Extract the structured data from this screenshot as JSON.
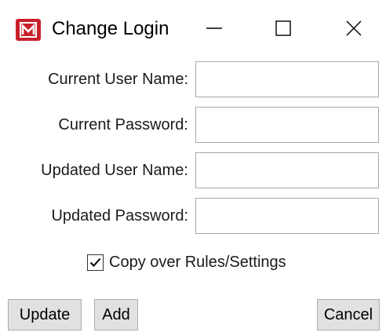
{
  "window": {
    "title": "Change Login",
    "icon": "app-logo-icon",
    "controls": [
      "minimize-icon",
      "maximize-icon",
      "close-icon"
    ]
  },
  "form": {
    "current_user_name": {
      "label": "Current User Name:",
      "value": ""
    },
    "current_password": {
      "label": "Current Password:",
      "value": ""
    },
    "updated_user_name": {
      "label": "Updated User Name:",
      "value": ""
    },
    "updated_password": {
      "label": "Updated Password:",
      "value": ""
    }
  },
  "copy_option": {
    "label": "Copy over Rules/Settings",
    "checked": true
  },
  "buttons": {
    "update": "Update",
    "add": "Add",
    "cancel": "Cancel"
  },
  "colors": {
    "brand": "#c8202a",
    "button_bg": "#e1e1e1",
    "field_border": "#a9a9a9"
  }
}
